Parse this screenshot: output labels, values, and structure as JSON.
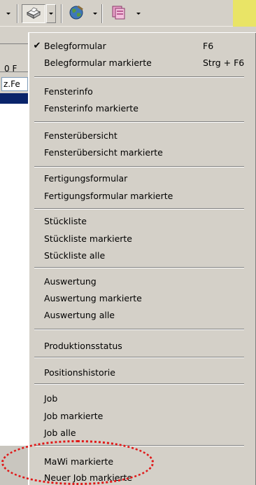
{
  "toolbar": {
    "buttons": [
      {
        "name": "printer-icon",
        "pressed": true
      },
      {
        "name": "globe-tools-icon",
        "pressed": false
      },
      {
        "name": "documents-icon",
        "pressed": false
      }
    ],
    "accent": "#e9e466"
  },
  "background": {
    "row1_text": "0 F",
    "field_text": "z.Fe"
  },
  "menu": {
    "items": [
      {
        "label": "Belegformular",
        "shortcut": "F6",
        "checked": true
      },
      {
        "label": "Belegformular markierte",
        "shortcut": "Strg + F6",
        "checked": false
      },
      {
        "label": "Fensterinfo"
      },
      {
        "label": "Fensterinfo markierte"
      },
      {
        "label": "Fensterübersicht"
      },
      {
        "label": "Fensterübersicht markierte"
      },
      {
        "label": "Fertigungsformular"
      },
      {
        "label": "Fertigungsformular markierte"
      },
      {
        "label": "Stückliste"
      },
      {
        "label": "Stückliste markierte"
      },
      {
        "label": "Stückliste alle"
      },
      {
        "label": "Auswertung"
      },
      {
        "label": "Auswertung markierte"
      },
      {
        "label": "Auswertung alle"
      },
      {
        "label": "Produktionsstatus"
      },
      {
        "label": "Positionshistorie"
      },
      {
        "label": "Job"
      },
      {
        "label": "Job markierte"
      },
      {
        "label": "Job alle"
      },
      {
        "label": "MaWi markierte"
      },
      {
        "label": "Neuer Job markierte"
      }
    ],
    "highlight_color": "#e01818"
  }
}
